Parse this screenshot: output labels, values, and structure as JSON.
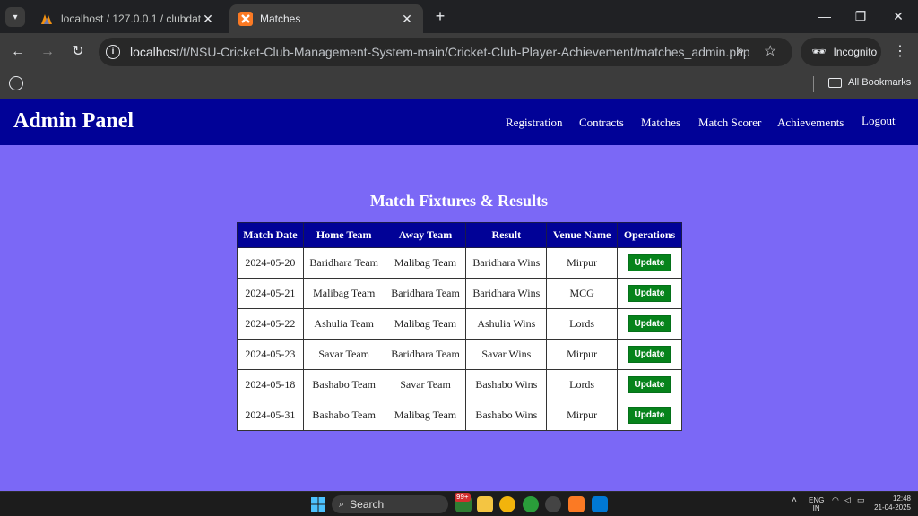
{
  "browser": {
    "tabs": [
      {
        "title": "localhost / 127.0.0.1 / clubdatabase",
        "icon": "phpmyadmin-icon"
      },
      {
        "title": "Matches",
        "icon": "xampp-icon",
        "active": true
      }
    ],
    "url_host": "localhost",
    "url_path": "/t/NSU-Cricket-Club-Management-System-main/Cricket-Club-Player-Achievement/matches_admin.php",
    "incognito_label": "Incognito",
    "bookmarks_label": "All Bookmarks"
  },
  "page": {
    "brand": "Admin Panel",
    "nav": [
      "Registration",
      "Contracts",
      "Matches",
      "Match Scorer",
      "Achievements",
      "Logout"
    ],
    "heading": "Match Fixtures & Results",
    "table": {
      "headers": [
        "Match Date",
        "Home Team",
        "Away Team",
        "Result",
        "Venue Name",
        "Operations"
      ],
      "rows": [
        [
          "2024-05-20",
          "Baridhara Team",
          "Malibag Team",
          "Baridhara Wins",
          "Mirpur",
          "Update"
        ],
        [
          "2024-05-21",
          "Malibag Team",
          "Baridhara Team",
          "Baridhara Wins",
          "MCG",
          "Update"
        ],
        [
          "2024-05-22",
          "Ashulia Team",
          "Malibag Team",
          "Ashulia Wins",
          "Lords",
          "Update"
        ],
        [
          "2024-05-23",
          "Savar Team",
          "Baridhara Team",
          "Savar Wins",
          "Mirpur",
          "Update"
        ],
        [
          "2024-05-18",
          "Bashabo Team",
          "Savar Team",
          "Bashabo Wins",
          "Lords",
          "Update"
        ],
        [
          "2024-05-31",
          "Bashabo Team",
          "Malibag Team",
          "Bashabo Wins",
          "Mirpur",
          "Update"
        ]
      ]
    },
    "colors": {
      "navbar": "#010297",
      "background": "#7b68f6",
      "update_button": "#06831b"
    }
  },
  "taskbar": {
    "search_label": "Search",
    "badge": "99+",
    "lang": "ENG",
    "region": "IN",
    "time": "12:48",
    "date": "21-04-2025"
  }
}
